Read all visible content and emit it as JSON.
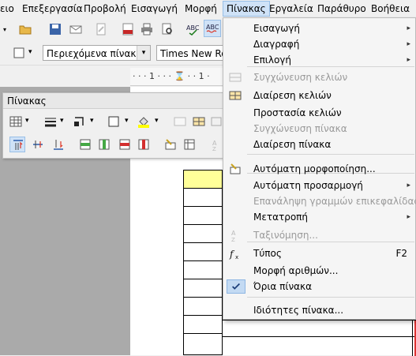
{
  "menubar": {
    "items": [
      "ειο",
      "Επεξεργασία",
      "Προβολή",
      "Εισαγωγή",
      "Μορφή",
      "Πίνακας",
      "Εργαλεία",
      "Παράθυρο",
      "Βοήθεια"
    ]
  },
  "toolbar": {
    "style_value": "Περιεχόμενα πίνακα",
    "font_value": "Times New Ro"
  },
  "ruler": {
    "text": "· · · 1 · · · ⌛ · · 1 ·"
  },
  "palette": {
    "title": "Πίνακας"
  },
  "menu": {
    "items": [
      {
        "label": "Εισαγωγή",
        "submenu": true
      },
      {
        "label": "Διαγραφή",
        "submenu": true
      },
      {
        "label": "Επιλογή",
        "submenu": true
      },
      {
        "label": "Συγχώνευση κελιών",
        "disabled": true,
        "icon": "merge-cells-icon"
      },
      {
        "label": "Διαίρεση κελιών",
        "icon": "split-cells-icon"
      },
      {
        "label": "Προστασία κελιών"
      },
      {
        "label": "Συγχώνευση πίνακα",
        "disabled": true
      },
      {
        "label": "Διαίρεση πίνακα"
      },
      {
        "label": "Αυτόματη μορφοποίηση...",
        "icon": "autoformat-icon"
      },
      {
        "label": "Αυτόματη προσαρμογή",
        "submenu": true
      },
      {
        "label": "Επανάληψη γραμμών επικεφαλίδας",
        "disabled": true
      },
      {
        "label": "Μετατροπή",
        "submenu": true
      },
      {
        "label": "Ταξινόμηση...",
        "disabled": true,
        "icon": "sort-icon"
      },
      {
        "label": "Τύπος",
        "shortcut": "F2",
        "icon": "formula-icon"
      },
      {
        "label": "Μορφή αριθμών..."
      },
      {
        "label": "Όρια πίνακα",
        "checked": true
      },
      {
        "label": "Ιδιότητες πίνακα..."
      }
    ]
  },
  "colors": {
    "accent": "#cfe2f7",
    "highlight": "#ffff99"
  }
}
